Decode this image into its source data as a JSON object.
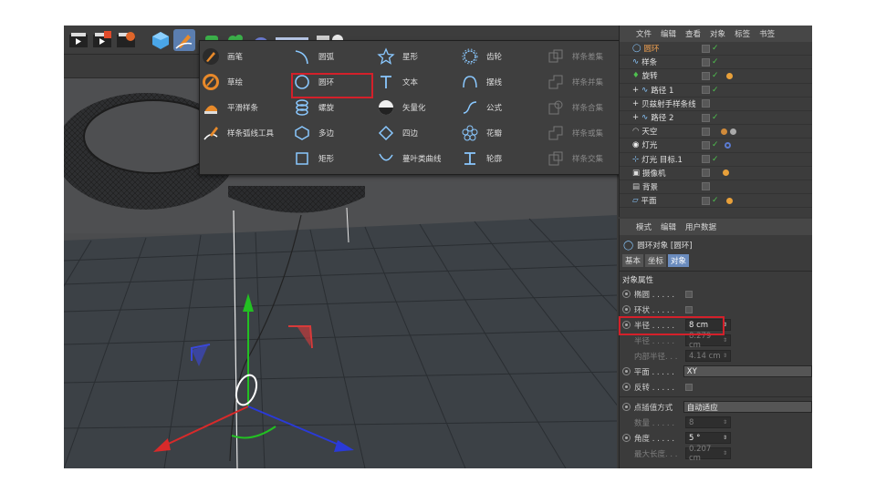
{
  "popup": {
    "col1": [
      {
        "label": "画笔",
        "icon": "pen-icon",
        "disabled": false
      },
      {
        "label": "草绘",
        "icon": "sketch-icon",
        "disabled": false
      },
      {
        "label": "平滑样条",
        "icon": "smooth-spline-icon",
        "disabled": false
      },
      {
        "label": "样条弧线工具",
        "icon": "spline-arc-tool-icon",
        "disabled": false
      }
    ],
    "col2": [
      {
        "label": "圆弧",
        "icon": "arc-icon"
      },
      {
        "label": "圆环",
        "icon": "circle-icon"
      },
      {
        "label": "螺旋",
        "icon": "helix-icon"
      },
      {
        "label": "多边",
        "icon": "polygon-icon"
      },
      {
        "label": "矩形",
        "icon": "rectangle-icon"
      }
    ],
    "col3": [
      {
        "label": "星形",
        "icon": "star-icon"
      },
      {
        "label": "文本",
        "icon": "text-icon"
      },
      {
        "label": "矢量化",
        "icon": "vectorize-icon"
      },
      {
        "label": "四边",
        "icon": "four-side-icon"
      },
      {
        "label": "蔓叶类曲线",
        "icon": "cissoid-icon"
      }
    ],
    "col4": [
      {
        "label": "齿轮",
        "icon": "gear-icon"
      },
      {
        "label": "摆线",
        "icon": "cycloid-icon"
      },
      {
        "label": "公式",
        "icon": "formula-icon"
      },
      {
        "label": "花瓣",
        "icon": "flower-icon"
      },
      {
        "label": "轮廓",
        "icon": "profile-icon"
      }
    ],
    "col5": [
      {
        "label": "样条差集",
        "icon": "spline-subtract-icon"
      },
      {
        "label": "样条并集",
        "icon": "spline-union-icon"
      },
      {
        "label": "样条合集",
        "icon": "spline-and-icon"
      },
      {
        "label": "样条或集",
        "icon": "spline-or-icon"
      },
      {
        "label": "样条交集",
        "icon": "spline-intersect-icon"
      }
    ]
  },
  "object_manager": {
    "menu": [
      "文件",
      "编辑",
      "查看",
      "对象",
      "标签",
      "书签"
    ],
    "objects": [
      {
        "name": "圆环",
        "selected": true
      },
      {
        "name": "样条"
      },
      {
        "name": "旋转"
      },
      {
        "name": "路径 1"
      },
      {
        "name": "贝兹射手样条线"
      },
      {
        "name": "路径 2"
      },
      {
        "name": "天空"
      },
      {
        "name": "灯光"
      },
      {
        "name": "灯光 目标.1"
      },
      {
        "name": "摄像机"
      },
      {
        "name": "背景"
      },
      {
        "name": "平面"
      }
    ]
  },
  "attributes": {
    "menu": [
      "模式",
      "编辑",
      "用户数据"
    ],
    "object_title": "圆环对象 [圆环]",
    "tabs": [
      "基本",
      "坐标",
      "对象"
    ],
    "active_tab": "对象",
    "section": "对象属性",
    "rows": {
      "ellipse": "椭圆 . . . . .",
      "ring": "环状 . . . . .",
      "radius_label": "半径 . . . . .",
      "radius_value": "8 cm",
      "radius2_label": "半径 . . . . .",
      "radius2_value": "8.279 cm",
      "inner_label": "内部半径. . .",
      "inner_value": "4.14 cm",
      "plane_label": "平面 . . . . .",
      "plane_value": "XY",
      "reverse_label": "反转 . . . . .",
      "interp_label": "点插值方式",
      "interp_value": "自动适应",
      "count_label": "数量 . . . . .",
      "count_value": "8",
      "angle_label": "角度 . . . . .",
      "angle_value": "5 °",
      "maxlen_label": "最大长度. . .",
      "maxlen_value": "0.207 cm"
    }
  },
  "colors": {
    "highlight": "#d4202a",
    "accent": "#6a8bbd",
    "axis_x": "#d82a2a",
    "axis_y": "#22c022",
    "axis_z": "#2a3ad8"
  }
}
